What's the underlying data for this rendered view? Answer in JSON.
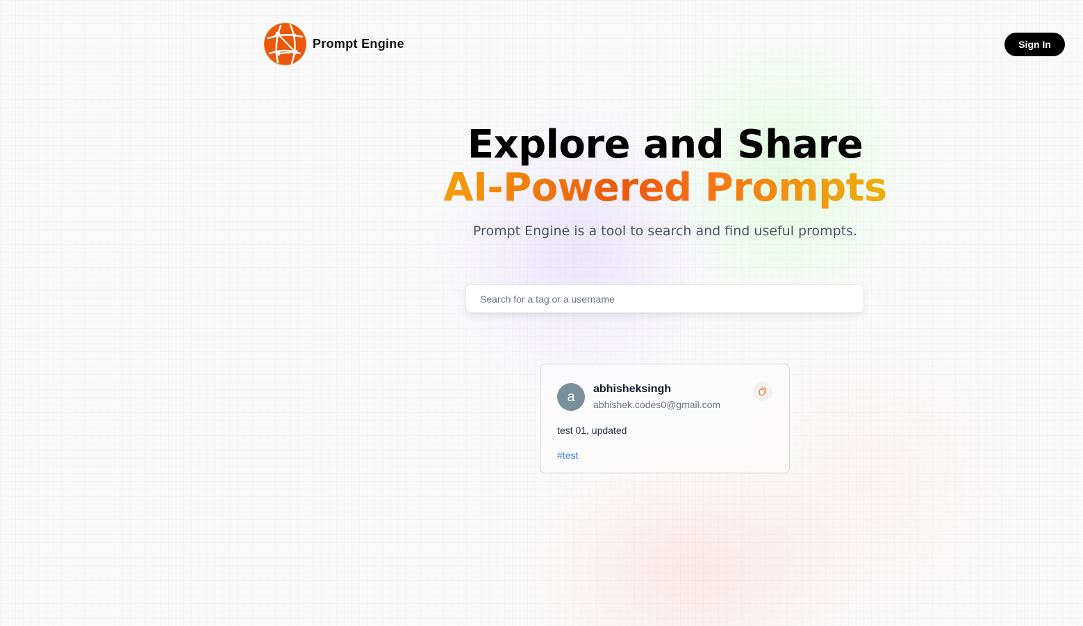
{
  "header": {
    "app_name": "Prompt Engine",
    "logo_icon": "globe-network-icon",
    "sign_in_label": "Sign In"
  },
  "hero": {
    "title_line1": "Explore and Share",
    "title_line2": "AI-Powered Prompts",
    "subtitle": "Prompt Engine is a tool to search and find useful prompts."
  },
  "search": {
    "placeholder": "Search for a tag or a username",
    "value": ""
  },
  "prompts": [
    {
      "avatar_letter": "a",
      "username": "abhisheksingh",
      "email": "abhishek.codes0@gmail.com",
      "prompt": "test 01, updated",
      "tag": "#test",
      "copy_icon": "copy-icon"
    }
  ],
  "colors": {
    "accent_orange": "#ea580c",
    "gradient_start": "#f59e0b",
    "gradient_end": "#eab308",
    "tag_blue": "#3b82f6",
    "avatar_bg": "#78909c",
    "button_bg": "#000000"
  }
}
